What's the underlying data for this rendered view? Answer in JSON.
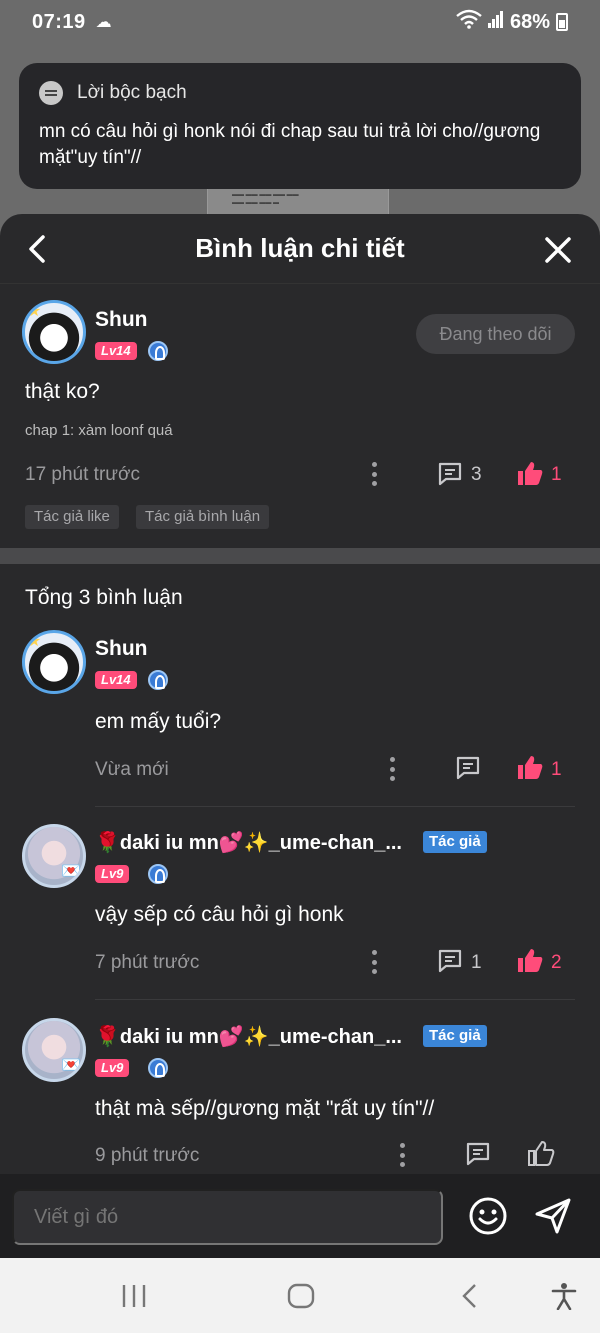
{
  "status_bar": {
    "time": "07:19",
    "battery": "68%"
  },
  "notice": {
    "title": "Lời bộc bạch",
    "body": "mn có câu hỏi gì honk nói đi chap sau tui trả lời cho//gương mặt\"uy tín\"//"
  },
  "header": {
    "title": "Bình luận chi tiết"
  },
  "main_comment": {
    "user": "Shun",
    "level": "Lv14",
    "follow_label": "Đang theo dõi",
    "text": "thật ko?",
    "context": "chap 1: xàm loonf quá",
    "time": "17 phút trước",
    "reply_count": "3",
    "like_count": "1",
    "tags": [
      "Tác giả like",
      "Tác giả bình luận"
    ]
  },
  "total_label": "Tổng 3 bình luận",
  "replies": [
    {
      "user": "Shun",
      "level": "Lv14",
      "text": "em mấy tuổi?",
      "time": "Vừa mới",
      "reply_count": "",
      "like_count": "1",
      "author": false
    },
    {
      "user": "🌹daki iu mn💕✨_ume-chan_...",
      "level": "Lv9",
      "author_label": "Tác giả",
      "text": "vậy sếp có câu hỏi gì honk",
      "time": "7 phút trước",
      "reply_count": "1",
      "like_count": "2",
      "author": true
    },
    {
      "user": "🌹daki iu mn💕✨_ume-chan_...",
      "level": "Lv9",
      "author_label": "Tác giả",
      "text": "thật mà sếp//gương mặt \"rất uy tín\"//",
      "time": "9 phút trước",
      "reply_count": "",
      "like_count": "",
      "author": true
    }
  ],
  "input": {
    "placeholder": "Viết gì đó"
  },
  "colors": {
    "accent_pink": "#ff4c7a",
    "author_blue": "#3b86d8",
    "sheet_bg": "#29292b"
  }
}
